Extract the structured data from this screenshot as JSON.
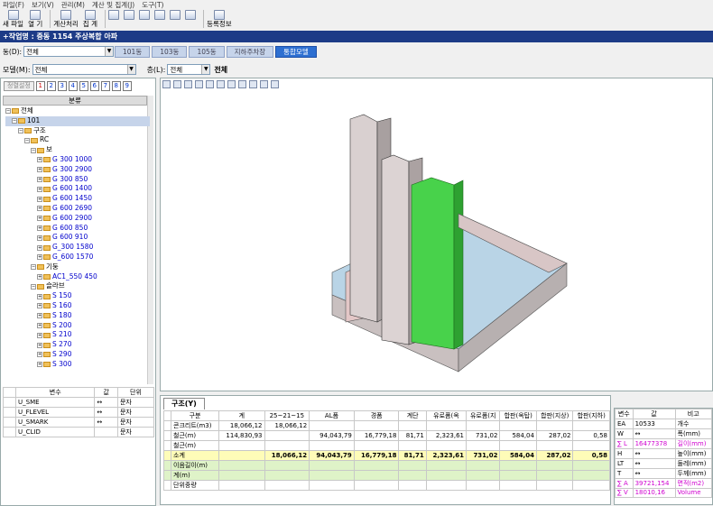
{
  "menu": [
    "파일(F)",
    "보기(V)",
    "관리(M)",
    "계산 및 집계(J)",
    "도구(T)"
  ],
  "toolbar": {
    "new_label": "새 파일",
    "open_label": "열 기",
    "calc_label": "계산처리",
    "total_label": "집 계",
    "reg_label": "등록정보"
  },
  "window_title": "+작업명 : 중동 1154 주상복합 아파",
  "building": {
    "label": "동(D):",
    "value": "전체"
  },
  "tabs": [
    "101동",
    "103동",
    "105동",
    "지하주차장",
    "통합모델"
  ],
  "model": {
    "label": "모델(M):",
    "value": "전체"
  },
  "floor": {
    "label": "층(L):",
    "value": "전체",
    "text": "전체"
  },
  "left": {
    "btn_label": "정렬설정",
    "numbers": [
      "1",
      "2",
      "3",
      "4",
      "5",
      "6",
      "7",
      "8",
      "9"
    ],
    "header": "분류"
  },
  "tree": [
    {
      "label": "전체",
      "level": 0,
      "color": "black"
    },
    {
      "label": "101",
      "level": 1,
      "color": "black"
    },
    {
      "label": "구조",
      "level": 2,
      "color": "black"
    },
    {
      "label": "RC",
      "level": 3,
      "color": "black"
    },
    {
      "label": "보",
      "level": 4,
      "color": "black"
    },
    {
      "label": "G 300 1000",
      "level": 5,
      "color": "blue"
    },
    {
      "label": "G 300 2900",
      "level": 5,
      "color": "blue"
    },
    {
      "label": "G 300 850",
      "level": 5,
      "color": "blue"
    },
    {
      "label": "G 600 1400",
      "level": 5,
      "color": "blue"
    },
    {
      "label": "G 600 1450",
      "level": 5,
      "color": "blue"
    },
    {
      "label": "G 600 2690",
      "level": 5,
      "color": "blue"
    },
    {
      "label": "G 600 2900",
      "level": 5,
      "color": "blue"
    },
    {
      "label": "G 600 850",
      "level": 5,
      "color": "blue"
    },
    {
      "label": "G 600 910",
      "level": 5,
      "color": "blue"
    },
    {
      "label": "G_300 1580",
      "level": 5,
      "color": "blue"
    },
    {
      "label": "G_600 1570",
      "level": 5,
      "color": "blue"
    },
    {
      "label": "기둥",
      "level": 4,
      "color": "black"
    },
    {
      "label": "AC1_550 450",
      "level": 5,
      "color": "blue"
    },
    {
      "label": "슬라브",
      "level": 4,
      "color": "black"
    },
    {
      "label": "S 150",
      "level": 5,
      "color": "blue"
    },
    {
      "label": "S 160",
      "level": 5,
      "color": "blue"
    },
    {
      "label": "S 180",
      "level": 5,
      "color": "blue"
    },
    {
      "label": "S 200",
      "level": 5,
      "color": "blue"
    },
    {
      "label": "S 210",
      "level": 5,
      "color": "blue"
    },
    {
      "label": "S 270",
      "level": 5,
      "color": "blue"
    },
    {
      "label": "S 290",
      "level": 5,
      "color": "blue"
    },
    {
      "label": "S 300",
      "level": 5,
      "color": "blue"
    }
  ],
  "props": {
    "headers": [
      "변수",
      "값",
      "단위"
    ],
    "rows": [
      [
        "U_SME",
        "↔",
        "문자"
      ],
      [
        "U_FLEVEL",
        "↔",
        "문자"
      ],
      [
        "U_SMARK",
        "↔",
        "문자"
      ],
      [
        "U_CLID",
        "",
        "문자"
      ]
    ]
  },
  "bottom": {
    "tab": "구조(Y)",
    "headers": [
      "구분",
      "계",
      "25~21~15",
      "AL폼",
      "경폼",
      "계단",
      "유로폼(옥",
      "유로폼(지",
      "합판(옥탑)",
      "합판(지상)",
      "합판(지하)"
    ],
    "rows": [
      [
        "콘크리트(m3)",
        "18,066,12",
        "18,066,12",
        "",
        "",
        "",
        "",
        "",
        "",
        "",
        ""
      ],
      [
        "철근(m)",
        "114,830,93",
        "",
        "94,043,79",
        "16,779,18",
        "81,71",
        "2,323,61",
        "731,02",
        "584,04",
        "287,02",
        "0,58"
      ],
      [
        "철근(m)",
        "",
        "",
        "",
        "",
        "",
        "",
        "",
        "",
        "",
        ""
      ],
      [
        "소계",
        "",
        "18,066,12",
        "94,043,79",
        "16,779,18",
        "81,71",
        "2,323,61",
        "731,02",
        "584,04",
        "287,02",
        "0,58"
      ],
      [
        "이음길이(m)",
        "",
        "",
        "",
        "",
        "",
        "",
        "",
        "",
        "",
        ""
      ],
      [
        "계(m)",
        "",
        "",
        "",
        "",
        "",
        "",
        "",
        "",
        "",
        ""
      ],
      [
        "단위중량",
        "",
        "",
        "",
        "",
        "",
        "",
        "",
        "",
        "",
        ""
      ]
    ]
  },
  "right": {
    "headers": [
      "변수",
      "값",
      "비고"
    ],
    "rows": [
      [
        "EA",
        "10533",
        "개수",
        "black"
      ],
      [
        "W",
        "↔",
        "폭(mm)",
        "black"
      ],
      [
        "∑ L",
        "16477378",
        "길이(mm)",
        "magenta"
      ],
      [
        "H",
        "↔",
        "높이(mm)",
        "black"
      ],
      [
        "LT",
        "↔",
        "둘레(mm)",
        "black"
      ],
      [
        "T",
        "↔",
        "두께(mm)",
        "black"
      ],
      [
        "∑ A",
        "39721,154",
        "면적(m2)",
        "magenta"
      ],
      [
        "∑ V",
        "18010,16",
        "Volume",
        "magenta"
      ]
    ]
  }
}
